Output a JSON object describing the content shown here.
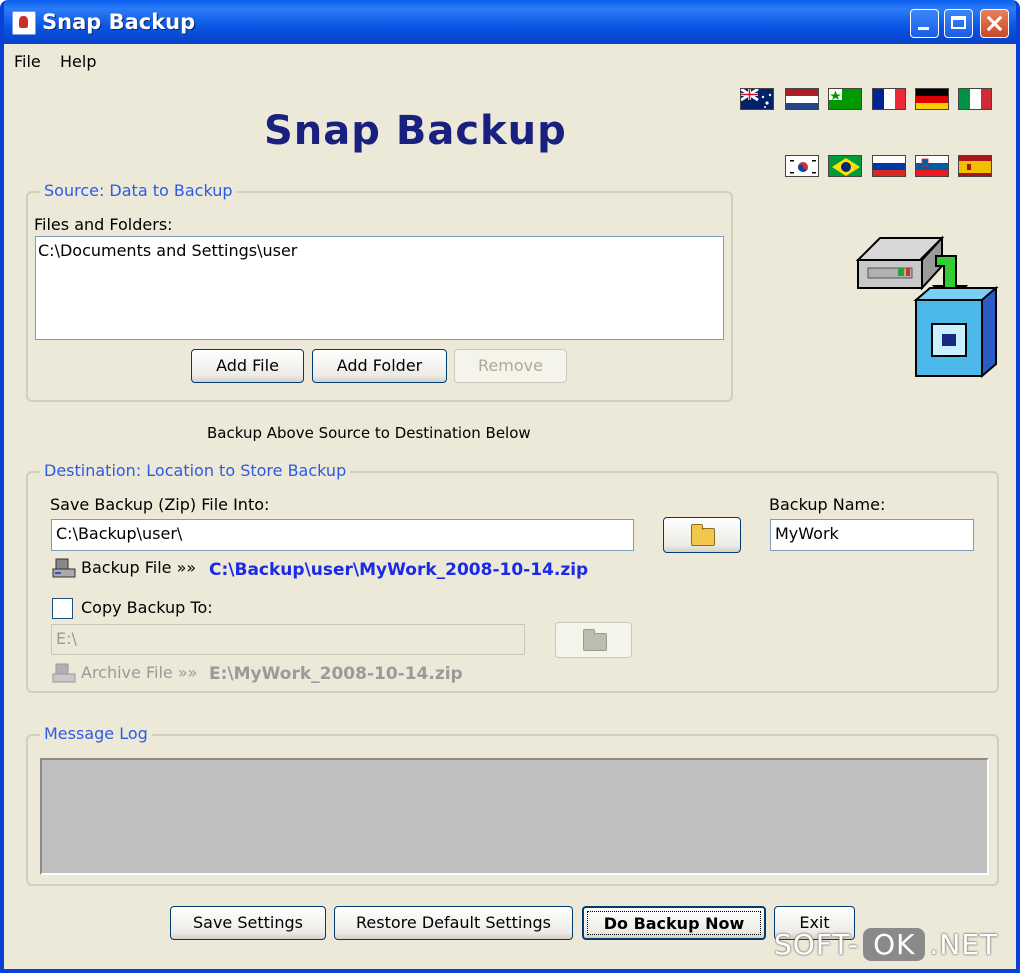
{
  "window": {
    "title": "Snap Backup"
  },
  "menu": {
    "file": "File",
    "help": "Help"
  },
  "header": {
    "logo_text": "Snap Backup"
  },
  "languages": [
    "english",
    "dutch",
    "esperanto",
    "french",
    "german",
    "italian",
    "korean",
    "portuguese",
    "russian",
    "slovenian",
    "spanish"
  ],
  "source": {
    "group_title": "Source: Data to Backup",
    "list_label": "Files and Folders:",
    "items": [
      "C:\\Documents and Settings\\user"
    ],
    "add_file": "Add File",
    "add_folder": "Add Folder",
    "remove": "Remove"
  },
  "instruction": "Backup Above Source to Destination Below",
  "destination": {
    "group_title": "Destination: Location to Store Backup",
    "save_label": "Save Backup (Zip) File Into:",
    "save_path": "C:\\Backup\\user\\",
    "name_label": "Backup Name:",
    "name_value": "MyWork",
    "backup_file_label": "Backup File »»",
    "backup_file_path": "C:\\Backup\\user\\MyWork_2008-10-14.zip",
    "copy_label": "Copy Backup To:",
    "copy_checked": false,
    "copy_path": "E:\\",
    "archive_file_label": "Archive File »»",
    "archive_file_path": "E:\\MyWork_2008-10-14.zip"
  },
  "log": {
    "group_title": "Message Log"
  },
  "footer": {
    "save_settings": "Save Settings",
    "restore_defaults": "Restore Default Settings",
    "do_backup": "Do Backup Now",
    "exit": "Exit"
  },
  "watermark": {
    "left": "SOFT-",
    "middle": "OK",
    "right": ".NET"
  },
  "colors": {
    "titlebar": "#0A55E4",
    "group_title": "#2D5AE6",
    "path_link": "#1A2AE6",
    "logo": "#1A2080"
  }
}
